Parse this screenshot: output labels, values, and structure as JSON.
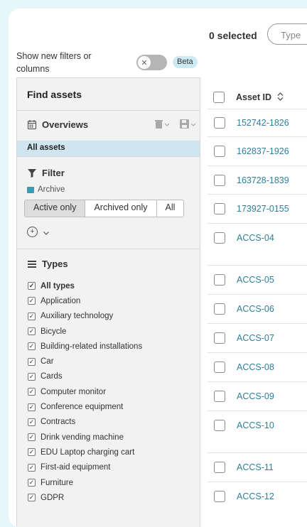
{
  "toolbar": {
    "selected_count": "0 selected",
    "type_filter_placeholder": "Type"
  },
  "toggle": {
    "label": "Show new filters or columns",
    "state": "off",
    "knob_symbol": "✕",
    "badge": "Beta"
  },
  "panel": {
    "title": "Find assets",
    "overviews": {
      "label": "Overviews",
      "selected_item": "All assets"
    },
    "filter": {
      "label": "Filter",
      "archive_label": "Archive",
      "archive_options": [
        "Active only",
        "Archived only",
        "All"
      ],
      "archive_selected": "Active only"
    },
    "types": {
      "label": "Types",
      "items": [
        {
          "label": "All types",
          "checked": true,
          "bold": true
        },
        {
          "label": "Application",
          "checked": true
        },
        {
          "label": "Auxiliary technology",
          "checked": true
        },
        {
          "label": "Bicycle",
          "checked": true
        },
        {
          "label": "Building-related installations",
          "checked": true
        },
        {
          "label": "Car",
          "checked": true
        },
        {
          "label": "Cards",
          "checked": true
        },
        {
          "label": "Computer monitor",
          "checked": true
        },
        {
          "label": "Conference equipment",
          "checked": true
        },
        {
          "label": "Contracts",
          "checked": true
        },
        {
          "label": "Drink vending machine",
          "checked": true
        },
        {
          "label": "EDU Laptop charging cart",
          "checked": true
        },
        {
          "label": "First-aid equipment",
          "checked": true
        },
        {
          "label": "Furniture",
          "checked": true
        },
        {
          "label": "GDPR",
          "checked": true
        }
      ]
    }
  },
  "table": {
    "column_header": "Asset ID",
    "rows": [
      {
        "asset_id": "152742-1826"
      },
      {
        "asset_id": "162837-1926"
      },
      {
        "asset_id": "163728-1839"
      },
      {
        "asset_id": "173927-0155"
      },
      {
        "asset_id": "ACCS-04"
      },
      {
        "asset_id": "ACCS-05"
      },
      {
        "asset_id": "ACCS-06"
      },
      {
        "asset_id": "ACCS-07"
      },
      {
        "asset_id": "ACCS-08"
      },
      {
        "asset_id": "ACCS-09"
      },
      {
        "asset_id": "ACCS-10"
      },
      {
        "asset_id": "ACCS-11"
      },
      {
        "asset_id": "ACCS-12"
      }
    ]
  },
  "colors": {
    "background": "#e6f6fb",
    "link": "#2d7f9c",
    "selected_row": "#cfe6f0",
    "archive_icon": "#3d9ab6",
    "toggle_off": "#b5b5b5"
  }
}
